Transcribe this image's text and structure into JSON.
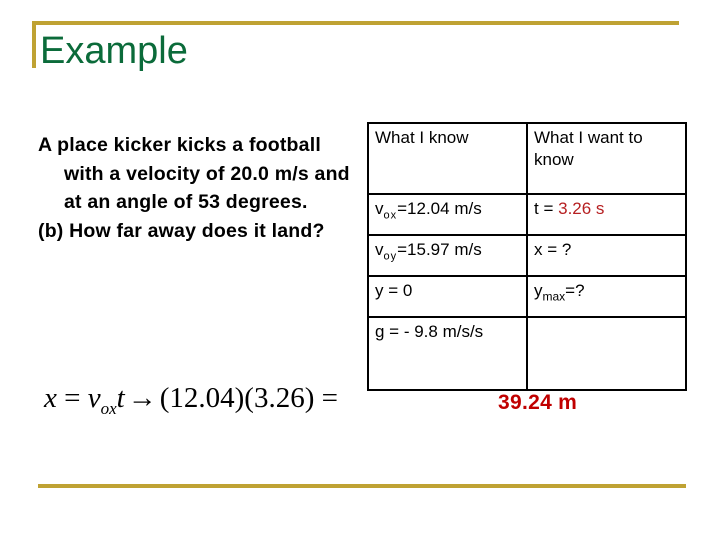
{
  "theme": {
    "accent_gold": "#bfa233",
    "title_green": "#0b6b3a",
    "highlight_red": "#c00000",
    "background": "#ffffff"
  },
  "header": {
    "title": "Example"
  },
  "problem": {
    "lines": [
      "A place kicker kicks a football with a velocity of 20.0 m/s and at an angle of 53 degrees.",
      "(b) How far away does it land?"
    ]
  },
  "table": {
    "headers": [
      "What I know",
      "What I want to know"
    ],
    "rows": [
      {
        "known": {
          "symbol": "v",
          "subscript": "ox",
          "rest": "=12.04 m/s"
        },
        "wanted": {
          "label": "t = ",
          "value": "3.26 s",
          "value_color": "#b61f21"
        }
      },
      {
        "known": {
          "symbol": "v",
          "subscript": "oy",
          "rest": "=15.97 m/s"
        },
        "wanted": {
          "label": "x = ?",
          "value": "",
          "value_color": ""
        }
      },
      {
        "known": {
          "symbol": "y = 0",
          "subscript": "",
          "rest": ""
        },
        "wanted": {
          "symbol": "y",
          "subscript": "max",
          "rest": "=?"
        }
      },
      {
        "known": {
          "symbol": "g = - 9.8 m/s/s",
          "subscript": "",
          "rest": ""
        },
        "wanted": {
          "label": "",
          "value": "",
          "value_color": ""
        }
      }
    ]
  },
  "equation": {
    "lhs_var": "x",
    "equals": " = ",
    "v_symbol": "v",
    "v_subscript": "ox",
    "t_symbol": "t",
    "arrow": "→",
    "substitution": "(12.04)(3.26) =",
    "result": "39.24 m"
  }
}
